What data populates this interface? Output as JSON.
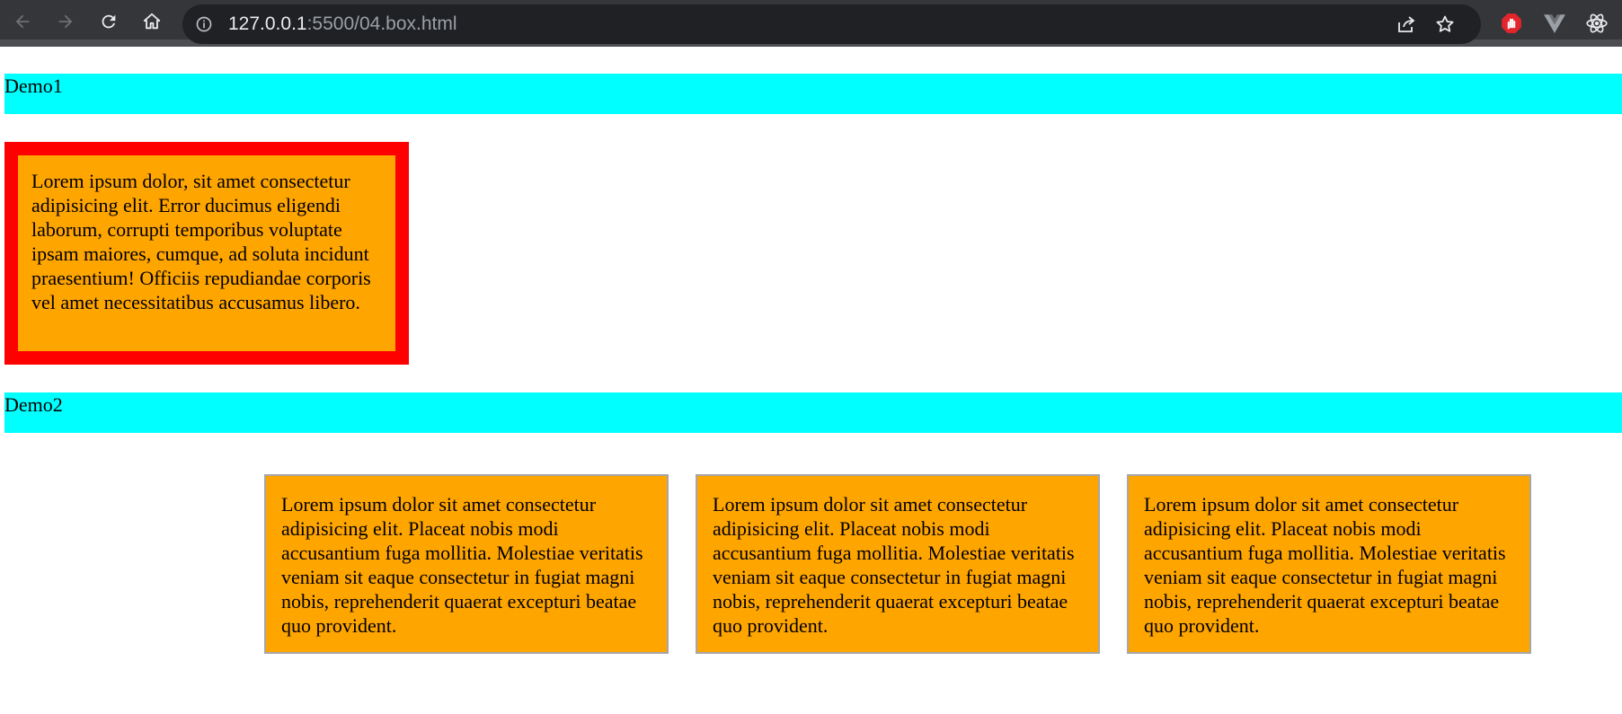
{
  "browser": {
    "url_host": "127.0.0.1",
    "url_rest": ":5500/04.box.html",
    "icons": [
      "back-icon",
      "forward-icon",
      "reload-icon",
      "home-icon",
      "info-icon",
      "share-icon",
      "star-icon",
      "adblock-icon",
      "vue-devtools-icon",
      "react-devtools-icon"
    ]
  },
  "page": {
    "demo1": {
      "label": "Demo1",
      "text": "Lorem ipsum dolor, sit amet consectetur adipisicing elit. Error ducimus eligendi laborum, corrupti temporibus voluptate ipsam maiores, cumque, ad soluta incidunt praesentium! Officiis repudiandae corporis vel amet necessitatibus accusamus libero."
    },
    "demo2": {
      "label": "Demo2",
      "cards": [
        {
          "text": "Lorem ipsum dolor sit amet consectetur adipisicing elit. Placeat nobis modi accusantium fuga mollitia. Molestiae veritatis veniam sit eaque consectetur in fugiat magni nobis, reprehenderit quaerat excepturi beatae quo provident."
        },
        {
          "text": "Lorem ipsum dolor sit amet consectetur adipisicing elit. Placeat nobis modi accusantium fuga mollitia. Molestiae veritatis veniam sit eaque consectetur in fugiat magni nobis, reprehenderit quaerat excepturi beatae quo provident."
        },
        {
          "text": "Lorem ipsum dolor sit amet consectetur adipisicing elit. Placeat nobis modi accusantium fuga mollitia. Molestiae veritatis veniam sit eaque consectetur in fugiat magni nobis, reprehenderit quaerat excepturi beatae quo provident."
        }
      ]
    }
  },
  "colors": {
    "label_bg": "#00ffff",
    "box_bg": "#ffa500",
    "box1_border": "#ff0000",
    "card_border": "#a6a6a6"
  }
}
